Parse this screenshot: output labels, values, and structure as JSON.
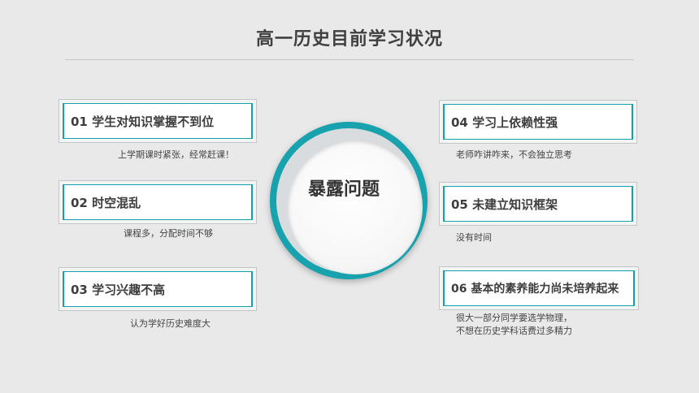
{
  "title": "高一历史目前学习状况",
  "center": "暴露问题",
  "items": [
    {
      "label": "01 学生对知识掌握不到位",
      "desc": [
        "上学期课时紧张，经常赶课！"
      ]
    },
    {
      "label": "02 时空混乱",
      "desc": [
        "课程多，分配时间不够"
      ]
    },
    {
      "label": "03 学习兴趣不高",
      "desc": [
        "认为学好历史难度大"
      ]
    },
    {
      "label": "04 学习上依赖性强",
      "desc": [
        "老师咋讲咋来，不会独立思考"
      ]
    },
    {
      "label": "05 未建立知识框架",
      "desc": [
        "没有时间"
      ]
    },
    {
      "label": "06 基本的素养能力尚未培养起来",
      "desc": [
        "很大一部分同学要选学物理，",
        "不想在历史学科话费过多精力"
      ]
    }
  ],
  "colors": {
    "accent": "#16a0ab",
    "background": "#e9e9ea"
  }
}
